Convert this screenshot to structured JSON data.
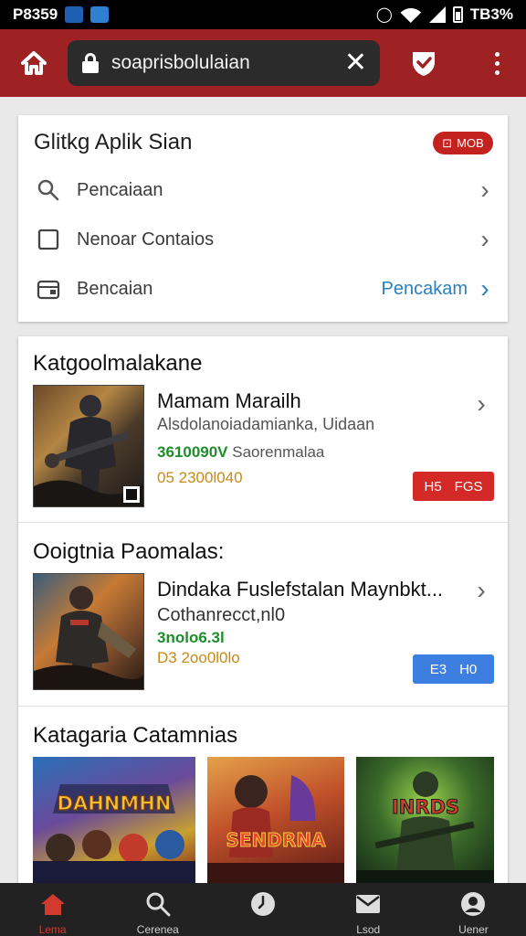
{
  "status_bar": {
    "time": "P8359",
    "battery_text": "TB3%",
    "alarm_icon": "alarm-icon"
  },
  "toolbar": {
    "url": "soaprisbolulaian",
    "home_icon": "home-icon",
    "shield_icon": "shield-check-icon",
    "menu_icon": "more-vert-icon"
  },
  "quick_card": {
    "title": "Glitkg Aplik Sian",
    "badge": "MOB",
    "rows": [
      {
        "label": "Pencaiaan",
        "icon": "search-icon",
        "link": ""
      },
      {
        "label": "Nenoar Contaios",
        "icon": "checkbox-icon",
        "link": ""
      },
      {
        "label": "Bencaian",
        "icon": "wallet-icon",
        "link": "Pencakam"
      }
    ]
  },
  "section1": {
    "title": "Katgoolmalakane",
    "game": {
      "name": "Mamam Marailh",
      "subtitle": "Alsdolanoiadamianka, Uidaan",
      "price_green": "3610090V",
      "price_gray": "Saorenmalaa",
      "date": "05 2300l040",
      "button": "H5",
      "button_extra": "FGS"
    }
  },
  "section2": {
    "title": "Ooigtnia Paomalas:",
    "game": {
      "name": "Dindaka Fuslefstalan Maynbkt...",
      "subtitle": "Cothanrecct,nl0",
      "price_green": "3nolo6.3l",
      "date": "D3 2oo0l0lo",
      "button": "E3",
      "button_extra": "H0"
    }
  },
  "section3": {
    "title": "Katagaria Catamnias",
    "tiles": [
      {
        "caption": "DAHNMHN"
      },
      {
        "caption": "SENDRNA"
      },
      {
        "caption": "INRDS"
      }
    ]
  },
  "bottom_nav": [
    {
      "label": "Lema",
      "icon": "home-icon",
      "active": true
    },
    {
      "label": "Cerenea",
      "icon": "search-icon",
      "active": false
    },
    {
      "label": "",
      "icon": "clock-icon",
      "active": false
    },
    {
      "label": "Lsod",
      "icon": "mail-icon",
      "active": false
    },
    {
      "label": "Uener",
      "icon": "account-icon",
      "active": false
    }
  ],
  "colors": {
    "brand": "#9e2223",
    "badge_red": "#c4221f",
    "link_blue": "#2a7fc0",
    "button_red": "#d42a27",
    "button_blue": "#3d7fe0",
    "price_green": "#1f8d2b",
    "date_gold": "#c88a14"
  }
}
